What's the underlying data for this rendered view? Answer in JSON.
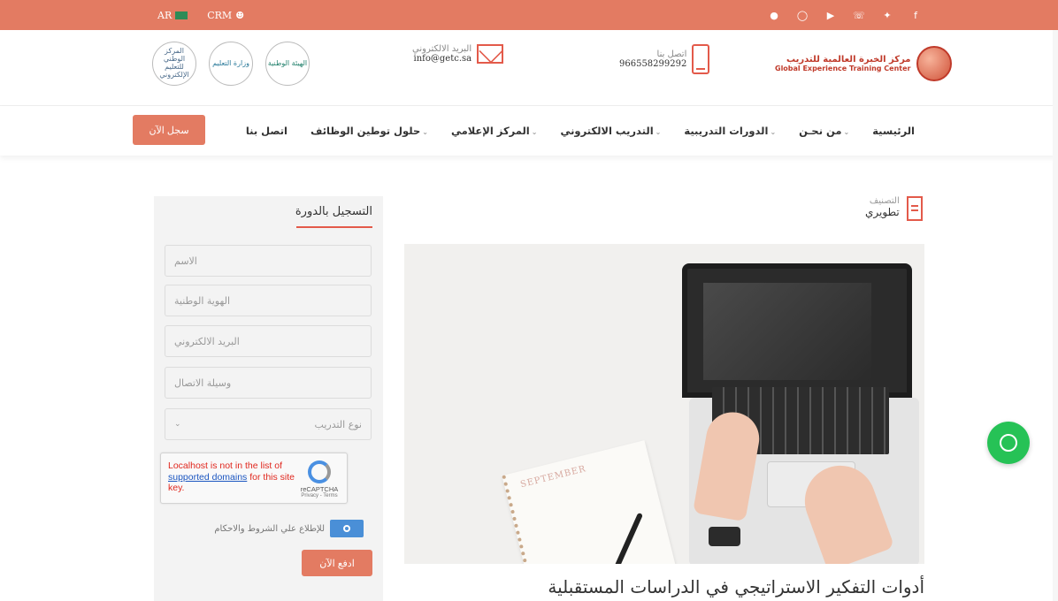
{
  "topbar": {
    "lang": "AR",
    "crm": "CRM",
    "social": [
      "circle-icon",
      "instagram-icon",
      "youtube-icon",
      "whatsapp-icon",
      "twitter-icon",
      "facebook-icon"
    ]
  },
  "header": {
    "partners": [
      {
        "name": "المركز الوطني للتعليم الإلكتروني"
      },
      {
        "name": "وزارة التعليم"
      },
      {
        "name": "الهيئة الوطنية"
      }
    ],
    "email_label": "البريد الالكتروني",
    "email_value": "info@getc.sa",
    "phone_label": "اتصل بنا",
    "phone_value": "966558299292",
    "brand_ar": "مركز الخبرة العالمية للتدريب",
    "brand_en": "Global Experience Training Center"
  },
  "nav": {
    "items": [
      {
        "label": "الرئيسية",
        "has_arrow": false
      },
      {
        "label": "من نحـن",
        "has_arrow": true
      },
      {
        "label": "الدورات التدريبية",
        "has_arrow": true
      },
      {
        "label": "التدريب الالكتروني",
        "has_arrow": true
      },
      {
        "label": "المركز الإعلامي",
        "has_arrow": true
      },
      {
        "label": "حلول توطين الوظائف",
        "has_arrow": true
      },
      {
        "label": "اتصل بنا",
        "has_arrow": false
      }
    ],
    "cta": "سجل الآن"
  },
  "category": {
    "label": "التصنيف",
    "value": "تطويري"
  },
  "post": {
    "title": "أدوات التفكير الاستراتيجي في الدراسات المستقبلية",
    "image_text": "SEPTEMBER"
  },
  "form": {
    "title": "التسجيل بالدورة",
    "name_placeholder": "الاسم",
    "id_placeholder": "الهوية الوطنية",
    "email_placeholder": "البريد الالكتروني",
    "contact_placeholder": "وسيلة الاتصال",
    "training_type": "نوع التدريب",
    "captcha_error_1": "Localhost is not in the list of",
    "captcha_error_link": "supported domains",
    "captcha_error_2": " for this site key.",
    "captcha_name": "reCAPTCHA",
    "captcha_links": "Privacy - Terms",
    "terms_label": "للإطلاع علي الشروط والاحكام",
    "pay_button": "ادفع الآن"
  },
  "colors": {
    "accent": "#e37b62",
    "red": "#e35a4a",
    "whatsapp": "#26c256",
    "toggle": "#4a8fd7"
  }
}
